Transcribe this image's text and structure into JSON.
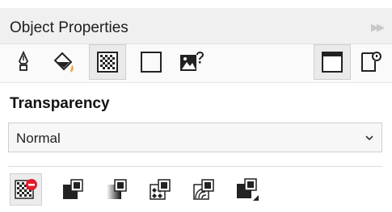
{
  "panel": {
    "title": "Object Properties",
    "collapse_icon": "double-chevron-right-icon"
  },
  "property_tabs": [
    {
      "icon": "pen-nib-icon",
      "selected": false
    },
    {
      "icon": "fill-bucket-icon",
      "selected": false
    },
    {
      "icon": "transparency-checker-icon",
      "selected": true
    },
    {
      "icon": "outline-square-icon",
      "selected": false
    },
    {
      "icon": "image-question-icon",
      "selected": false
    }
  ],
  "right_tabs": [
    {
      "icon": "frame-window-icon",
      "selected": true
    },
    {
      "icon": "summary-properties-icon",
      "selected": false
    }
  ],
  "section": {
    "title": "Transparency"
  },
  "merge_mode": {
    "value": "Normal",
    "caret_icon": "chevron-down-icon"
  },
  "transparency_types": [
    {
      "icon": "no-transparency-icon",
      "selected": true
    },
    {
      "icon": "uniform-transparency-icon",
      "selected": false
    },
    {
      "icon": "fountain-transparency-icon",
      "selected": false
    },
    {
      "icon": "vector-pattern-transparency-icon",
      "selected": false
    },
    {
      "icon": "bitmap-pattern-transparency-icon",
      "selected": false
    },
    {
      "icon": "texture-transparency-icon",
      "selected": false
    }
  ],
  "colors": {
    "accent_orange": "#f2a33a",
    "no_transparency_red": "#e21b2a",
    "titlebar_bg": "#f0f0f0"
  }
}
